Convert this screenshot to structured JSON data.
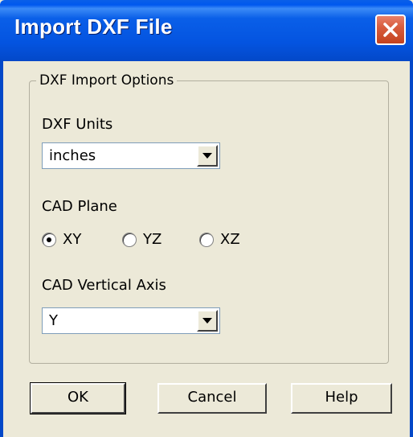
{
  "window": {
    "title": "Import DXF File"
  },
  "group": {
    "legend": "DXF Import Options"
  },
  "units": {
    "label": "DXF Units",
    "value": "inches"
  },
  "plane": {
    "label": "CAD Plane",
    "options": [
      "XY",
      "YZ",
      "XZ"
    ],
    "selected": "XY"
  },
  "vertical_axis": {
    "label": "CAD Vertical Axis",
    "value": "Y"
  },
  "buttons": {
    "ok": "OK",
    "cancel": "Cancel",
    "help": "Help"
  },
  "colors": {
    "title_bar": "#0454E0",
    "dialog_bg": "#ECE9D8",
    "close_button": "#D85D3E"
  }
}
